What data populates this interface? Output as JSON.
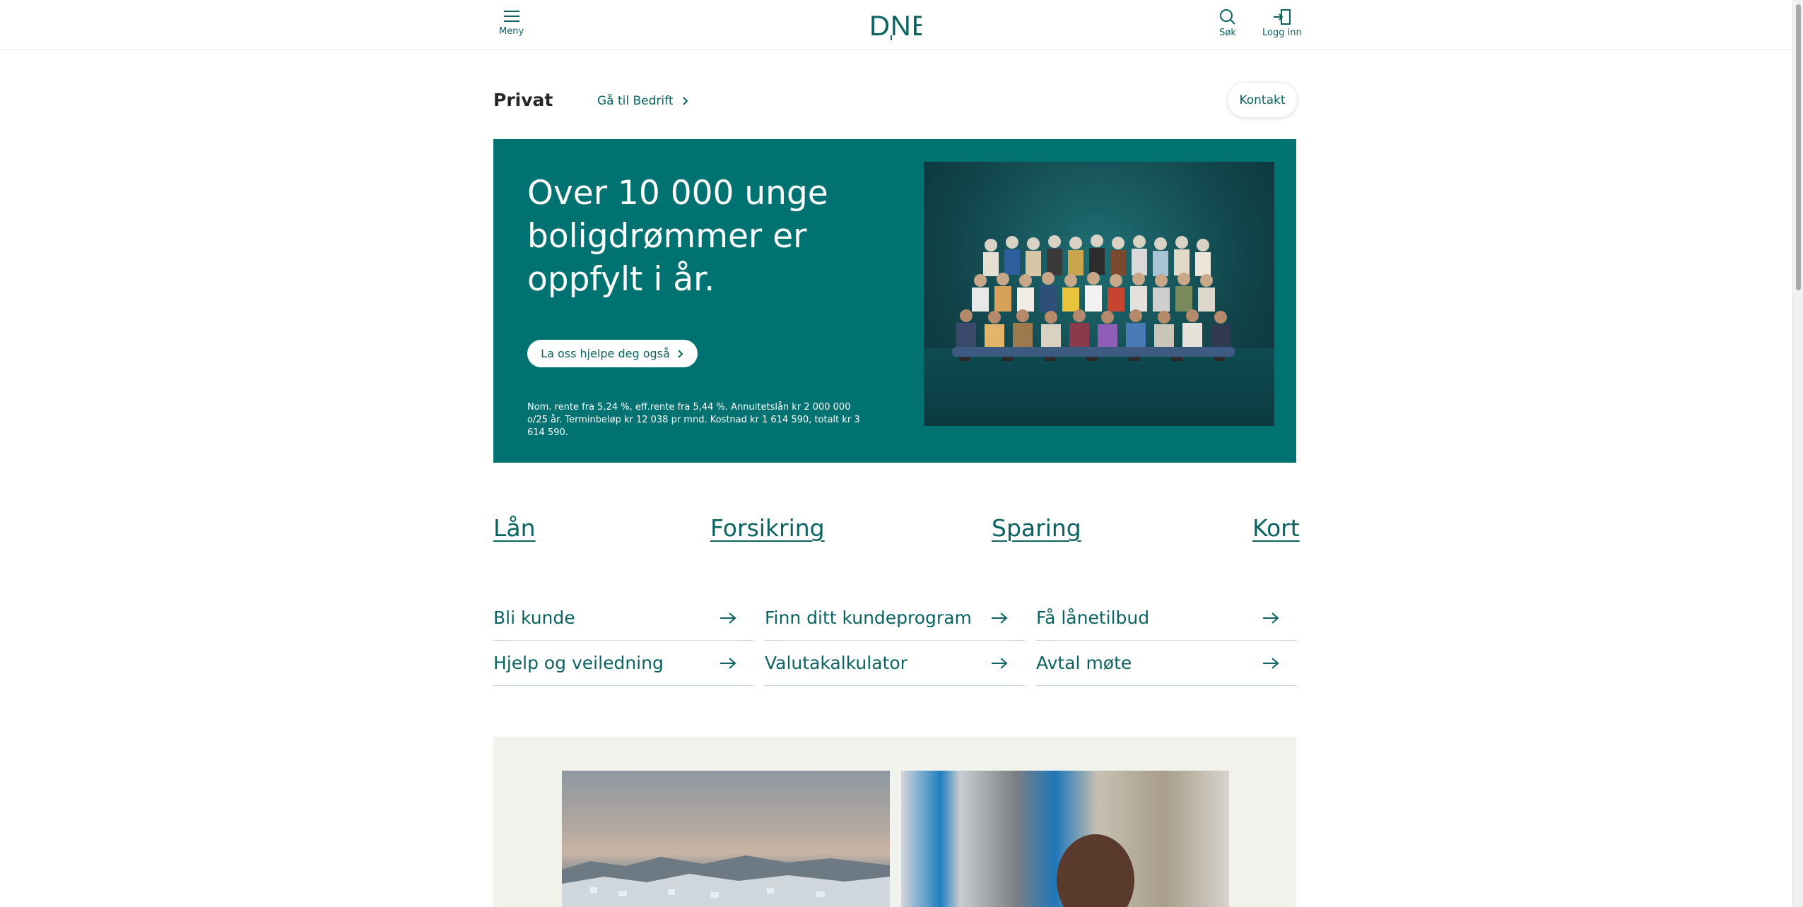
{
  "header": {
    "menu_label": "Meny",
    "logo_text": "DNB",
    "search_label": "Søk",
    "login_label": "Logg inn"
  },
  "segment": {
    "title": "Privat",
    "switch_link": "Gå til Bedrift",
    "contact_button": "Kontakt"
  },
  "hero": {
    "title": "Over 10 000 unge boligdrømmer er oppfylt i år.",
    "cta": "La oss hjelpe deg også",
    "fine_print": "Nom. rente fra 5,24 %, eff.rente fra 5,44 %. Annuitetslån kr 2 000 000 o/25 år. Terminbeløp kr 12 038 pr mnd. Kostnad kr 1 614 590, totalt kr 3 614 590."
  },
  "categories": [
    "Lån",
    "Forsikring",
    "Sparing",
    "Kort"
  ],
  "quick_links": [
    "Bli kunde",
    "Finn ditt kundeprogram",
    "Få lånetilbud",
    "Hjelp og veiledning",
    "Valutakalkulator",
    "Avtal møte"
  ],
  "colors": {
    "brand_teal": "#007272",
    "link_teal": "#0b6363",
    "section_bg": "#f2f2ec"
  },
  "icons": [
    "menu-icon",
    "search-icon",
    "login-icon",
    "chevron-right-icon",
    "arrow-right-icon"
  ]
}
